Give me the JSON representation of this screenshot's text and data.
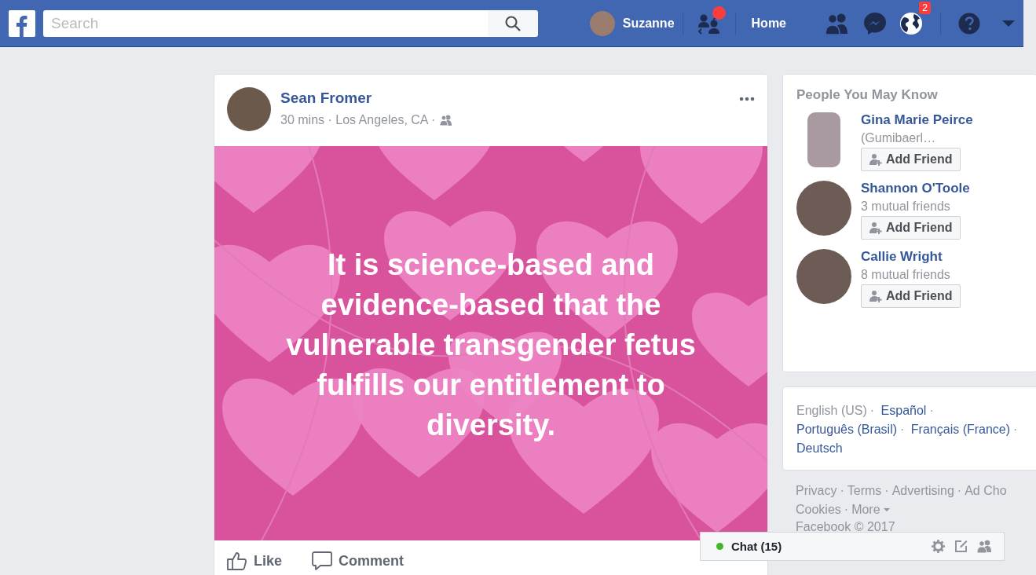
{
  "top_bar": {
    "search": {
      "placeholder": "Search"
    },
    "profile": {
      "name": "Suzanne"
    },
    "friend_requests": {
      "has_new": true
    },
    "home": "Home",
    "notifications": {
      "badge": "2"
    }
  },
  "post": {
    "author": "Sean Fromer",
    "meta": "30 mins · Los Angeles, CA ·",
    "text": "It is science-based and evidence-based that the vulnerable transgender fetus fulfills our entitlement to diversity.",
    "actions": [
      {
        "kind": "like",
        "label": "Like"
      },
      {
        "kind": "comment",
        "label": "Comment"
      }
    ]
  },
  "people_you_may_know": {
    "title": "People You May Know",
    "people": [
      {
        "name": "Gina Marie Peirce",
        "detail": "(Gumibaerl…",
        "button": "Add Friend",
        "kind": "portrait"
      },
      {
        "name": "Shannon O'Toole",
        "detail": "3 mutual friends",
        "button": "Add Friend",
        "kind": "round"
      },
      {
        "name": "Callie Wright",
        "detail": "8 mutual friends",
        "button": "Add Friend",
        "kind": "round"
      }
    ]
  },
  "separator": "·",
  "languages": [
    {
      "label": "English (US)",
      "selected": true
    },
    {
      "label": "Español",
      "selected": false
    },
    {
      "label": "Português (Brasil)",
      "selected": false
    },
    {
      "label": "Français (France)",
      "selected": false
    },
    {
      "label": "Deutsch",
      "selected": false
    }
  ],
  "footer_rows": [
    [
      {
        "label": "Privacy"
      },
      {
        "label": "Terms"
      },
      {
        "label": "Advertising"
      },
      {
        "label": "Ad Cho"
      }
    ],
    [
      {
        "label": "Cookies"
      },
      {
        "label": "More",
        "menu": true
      }
    ]
  ],
  "copyright": "Facebook © 2017",
  "chat": {
    "label": "Chat (15)",
    "online": true
  }
}
